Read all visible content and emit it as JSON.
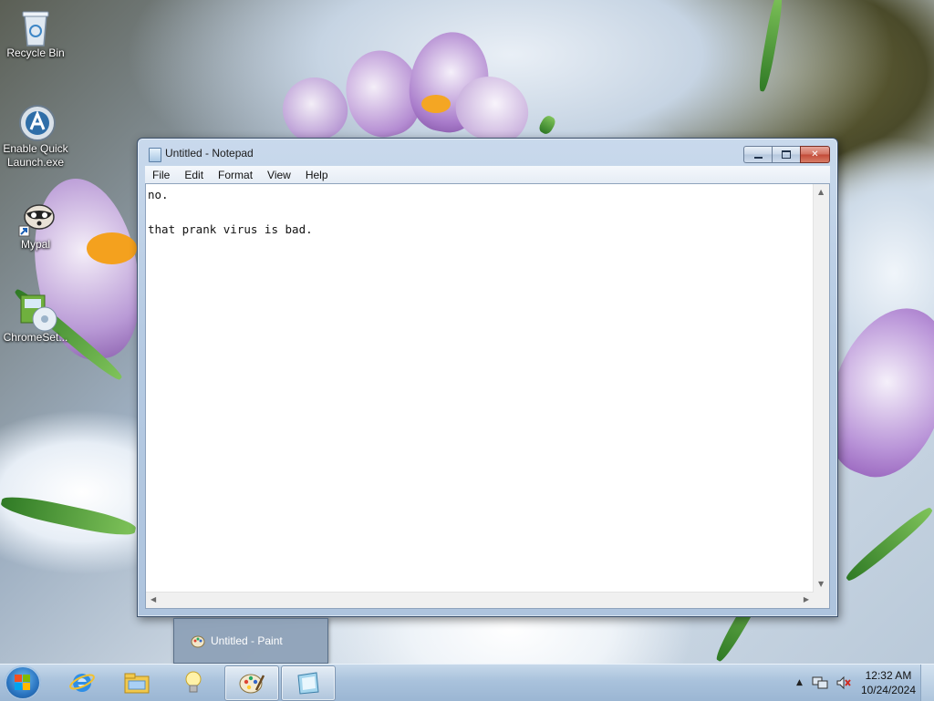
{
  "desktop": {
    "icons": [
      {
        "label": "Recycle Bin",
        "icon": "recycle-bin-icon"
      },
      {
        "label": "Enable Quick Launch.exe",
        "icon": "quick-launch-icon"
      },
      {
        "label": "Mypal",
        "icon": "mypal-raccoon-icon"
      },
      {
        "label": "ChromeSet...",
        "icon": "chrome-setup-icon"
      }
    ]
  },
  "notepad": {
    "title": "Untitled - Notepad",
    "menu": [
      "File",
      "Edit",
      "Format",
      "View",
      "Help"
    ],
    "content": "no.\n\nthat prank virus is bad."
  },
  "popup": {
    "label": "Untitled - Paint"
  },
  "taskbar": {
    "pinned": [
      "internet-explorer-icon",
      "windows-explorer-icon",
      "lightbulb-icon",
      "paint-icon",
      "notepad-icon"
    ],
    "clock": {
      "time": "12:32 AM",
      "date": "10/24/2024"
    }
  }
}
